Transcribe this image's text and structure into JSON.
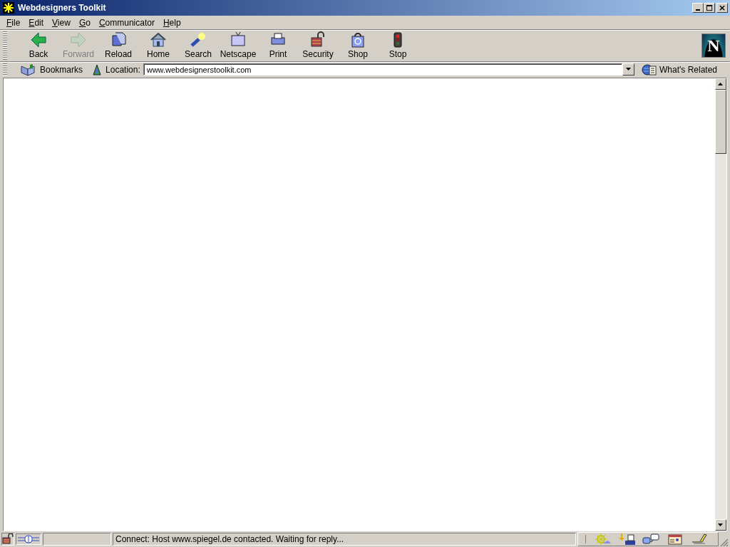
{
  "window": {
    "title": "Webdesigners Toolkit"
  },
  "menu": [
    {
      "label": "File"
    },
    {
      "label": "Edit"
    },
    {
      "label": "View"
    },
    {
      "label": "Go"
    },
    {
      "label": "Communicator"
    },
    {
      "label": "Help"
    }
  ],
  "toolbar": [
    {
      "label": "Back",
      "kind": "back",
      "disabled": false
    },
    {
      "label": "Forward",
      "kind": "forward",
      "disabled": true
    },
    {
      "label": "Reload",
      "kind": "reload",
      "disabled": false
    },
    {
      "label": "Home",
      "kind": "home",
      "disabled": false
    },
    {
      "label": "Search",
      "kind": "search",
      "disabled": false
    },
    {
      "label": "Netscape",
      "kind": "netscape",
      "disabled": false
    },
    {
      "label": "Print",
      "kind": "print",
      "disabled": false
    },
    {
      "label": "Security",
      "kind": "security",
      "disabled": false
    },
    {
      "label": "Shop",
      "kind": "shop",
      "disabled": false
    },
    {
      "label": "Stop",
      "kind": "stop",
      "disabled": false
    }
  ],
  "location_bar": {
    "bookmarks": "Bookmarks",
    "location_label": "Location:",
    "url": "www.webdesignerstoolkit.com",
    "whats_related": "What's Related"
  },
  "logo": {
    "letter": "N"
  },
  "status_bar": {
    "progress": {
      "level": 0
    },
    "message": "Connect: Host www.spiegel.de contacted. Waiting for reply..."
  }
}
